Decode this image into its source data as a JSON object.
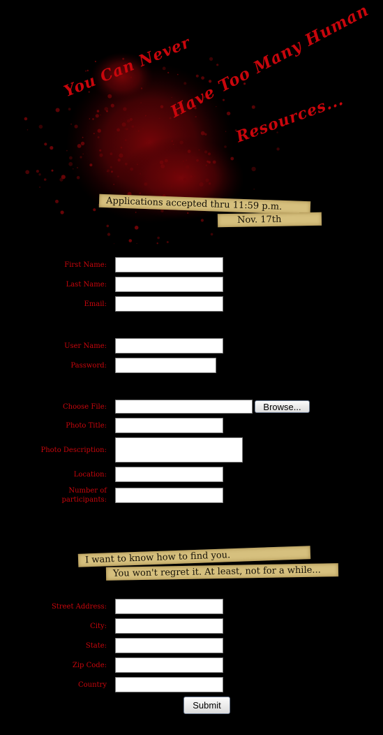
{
  "header": {
    "headline_line1": "You Can Never",
    "headline_line2": "Have Too Many Human",
    "headline_line3": "Resources...",
    "banner_line1": "Applications accepted thru 11:59 p.m.",
    "banner_line2": "Nov. 17th"
  },
  "account_section": {
    "first_name_label": "First Name:",
    "last_name_label": "Last Name:",
    "email_label": "Email:",
    "username_label": "User Name:",
    "password_label": "Password:"
  },
  "photo_section": {
    "choose_file_label": "Choose File:",
    "browse_button": "Browse...",
    "photo_title_label": "Photo Title:",
    "photo_description_label": "Photo Description:",
    "location_label": "Location:",
    "participants_label_line1": "Number of",
    "participants_label_line2": "participants:"
  },
  "address_banner": {
    "line1": "I want to know how to find you.",
    "line2": "You won't regret it. At least, not for a while..."
  },
  "address_section": {
    "street_label": "Street Address:",
    "city_label": "City:",
    "state_label": "State:",
    "zip_label": "Zip Code:",
    "country_label": "Country"
  },
  "submit_button": "Submit",
  "colors": {
    "background": "#000000",
    "label_red": "#c8060c",
    "tape": "#d6c07e"
  }
}
